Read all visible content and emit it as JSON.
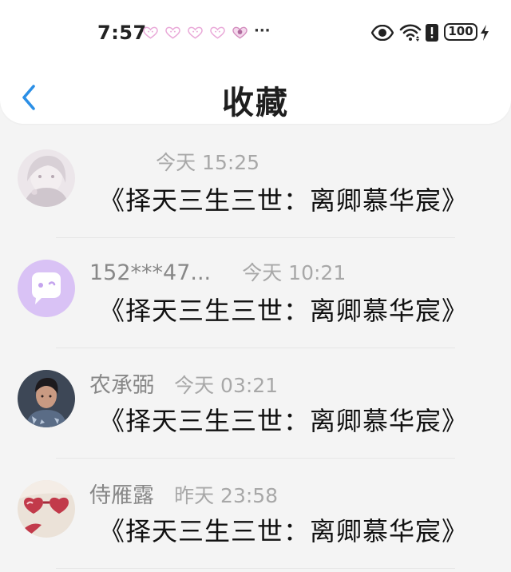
{
  "status_bar": {
    "time": "7:57",
    "notification_icons": [
      "heart-chat-icon",
      "heart-chat-icon",
      "heart-chat-icon",
      "heart-chat-icon",
      "heart-badge-icon"
    ],
    "more": "···",
    "battery": "100"
  },
  "header": {
    "title": "收藏"
  },
  "favorites": [
    {
      "sender": "",
      "time": "今天 15:25",
      "content": "《择天三生三世：离卿慕华宸》",
      "avatar": "girl-photo"
    },
    {
      "sender": "152***47...",
      "time": "今天 10:21",
      "content": "《择天三生三世：离卿慕华宸》",
      "avatar": "chat-bubble-default"
    },
    {
      "sender": "农承弼",
      "time": "今天 03:21",
      "content": "《择天三生三世：离卿慕华宸》",
      "avatar": "man-photo"
    },
    {
      "sender": "侍雁露",
      "time": "昨天 23:58",
      "content": "《择天三生三世：离卿慕华宸》",
      "avatar": "heart-glasses-photo"
    }
  ],
  "colors": {
    "accent": "#2b8fe6",
    "default_avatar": "#d9c2f5"
  }
}
